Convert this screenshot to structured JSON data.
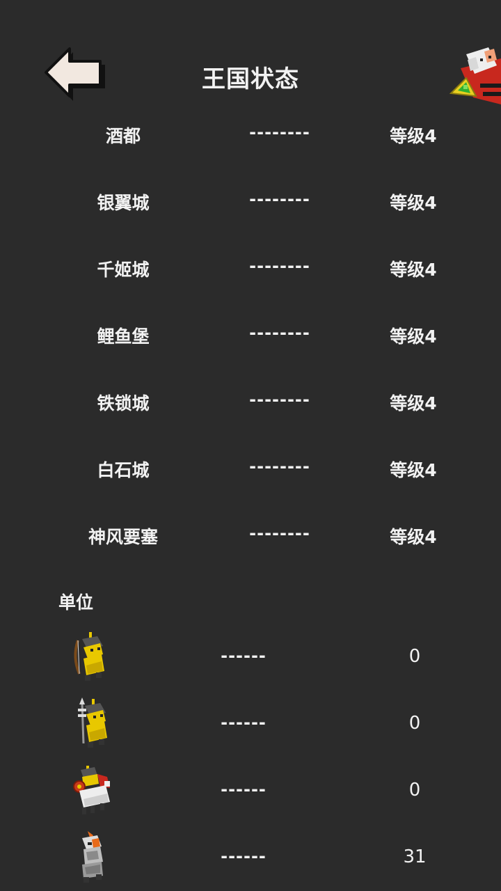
{
  "header": {
    "title": "王国状态",
    "back_icon": "back-arrow-icon",
    "avatar_icon": "king-avatar-icon"
  },
  "cities": [
    {
      "name": "酒都",
      "status": "--------",
      "level": "等级4"
    },
    {
      "name": "银翼城",
      "status": "--------",
      "level": "等级4"
    },
    {
      "name": "千姬城",
      "status": "--------",
      "level": "等级4"
    },
    {
      "name": "鲤鱼堡",
      "status": "--------",
      "level": "等级4"
    },
    {
      "name": "铁锁城",
      "status": "--------",
      "level": "等级4"
    },
    {
      "name": "白石城",
      "status": "--------",
      "level": "等级4"
    },
    {
      "name": "神风要塞",
      "status": "--------",
      "level": "等级4"
    }
  ],
  "units_section": {
    "title": "单位",
    "units": [
      {
        "icon": "archer-unit-icon",
        "status": "------",
        "count": "0"
      },
      {
        "icon": "spearman-unit-icon",
        "status": "------",
        "count": "0"
      },
      {
        "icon": "cavalry-unit-icon",
        "status": "------",
        "count": "0"
      },
      {
        "icon": "knight-unit-icon",
        "status": "------",
        "count": "31"
      }
    ]
  },
  "colors": {
    "background": "#2b2b2b",
    "text": "#f2f2f2",
    "unit_yellow": "#e8c800",
    "arrow_fill": "#f2e8e0"
  }
}
